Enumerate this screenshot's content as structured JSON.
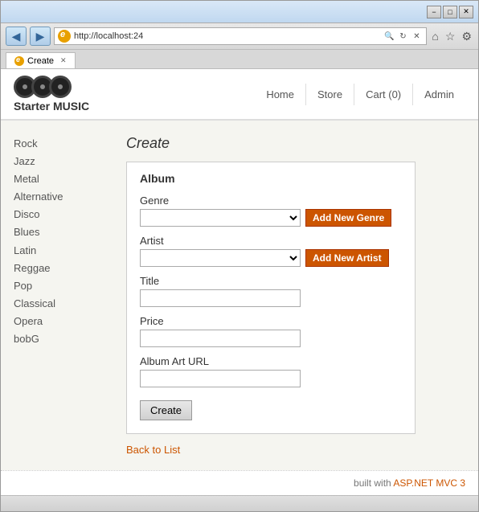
{
  "window": {
    "title": "Create",
    "minimize_label": "−",
    "restore_label": "□",
    "close_label": "✕"
  },
  "browser": {
    "address": "http://localhost:24",
    "tab_title": "Create",
    "search_placeholder": "🔍",
    "nav_back": "◀",
    "nav_forward": "▶",
    "addr_search": "🔍",
    "addr_refresh": "↻",
    "addr_stop": "✕",
    "icon_home": "⌂",
    "icon_fav": "☆",
    "icon_settings": "⚙"
  },
  "site": {
    "title": "Starter MUSIC",
    "nav": {
      "home": "Home",
      "store": "Store",
      "cart": "Cart (0)",
      "admin": "Admin"
    }
  },
  "sidebar": {
    "items": [
      {
        "label": "Rock"
      },
      {
        "label": "Jazz"
      },
      {
        "label": "Metal"
      },
      {
        "label": "Alternative"
      },
      {
        "label": "Disco"
      },
      {
        "label": "Blues"
      },
      {
        "label": "Latin"
      },
      {
        "label": "Reggae"
      },
      {
        "label": "Pop"
      },
      {
        "label": "Classical"
      },
      {
        "label": "Opera"
      },
      {
        "label": "bobG"
      }
    ]
  },
  "content": {
    "page_title": "Create",
    "form": {
      "box_title": "Album",
      "genre_label": "Genre",
      "genre_add_btn": "Add New Genre",
      "artist_label": "Artist",
      "artist_add_btn": "Add New Artist",
      "title_label": "Title",
      "price_label": "Price",
      "album_art_label": "Album Art URL",
      "create_btn": "Create"
    },
    "back_link": "Back to List"
  },
  "footer": {
    "text": "built with ",
    "highlight": "ASP.NET MVC 3"
  },
  "status": {
    "text": ""
  }
}
